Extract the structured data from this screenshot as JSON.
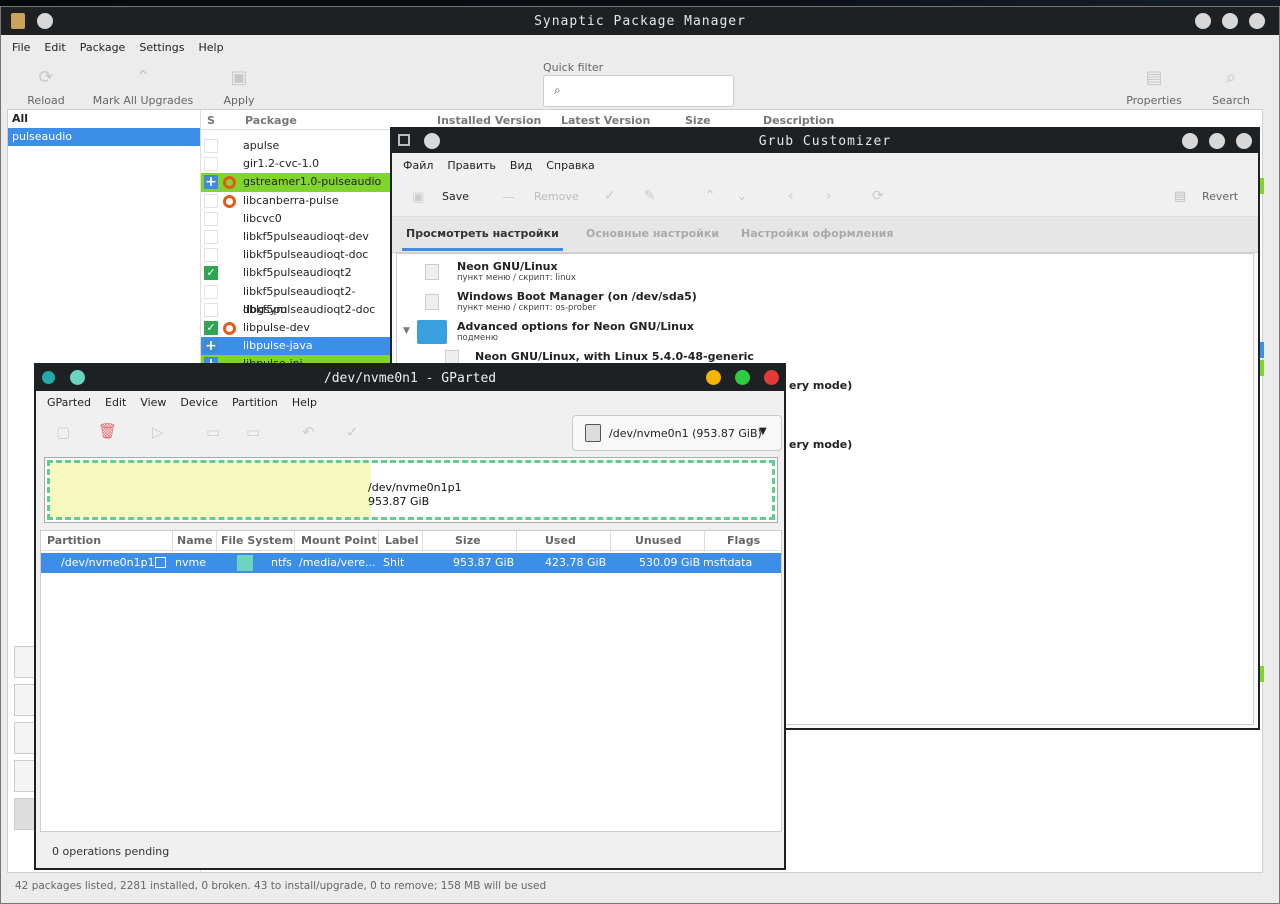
{
  "synaptic": {
    "title": "Synaptic Package Manager",
    "menu": [
      "File",
      "Edit",
      "Package",
      "Settings",
      "Help"
    ],
    "toolbar": {
      "reload": "Reload",
      "mark_all": "Mark All Upgrades",
      "apply": "Apply",
      "quick_filter": "Quick filter",
      "properties": "Properties",
      "search": "Search"
    },
    "categories": [
      "All",
      "pulseaudio"
    ],
    "columns": {
      "s": "S",
      "package": "Package",
      "installed": "Installed Version",
      "latest": "Latest Version",
      "size": "Size",
      "description": "Description"
    },
    "packages": [
      {
        "name": "apulse",
        "status": "none",
        "ubuntu": false,
        "hl": ""
      },
      {
        "name": "gir1.2-cvc-1.0",
        "status": "none",
        "ubuntu": false,
        "hl": ""
      },
      {
        "name": "gstreamer1.0-pulseaudio",
        "status": "install",
        "ubuntu": true,
        "hl": "green"
      },
      {
        "name": "libcanberra-pulse",
        "status": "none",
        "ubuntu": true,
        "hl": ""
      },
      {
        "name": "libcvc0",
        "status": "none",
        "ubuntu": false,
        "hl": ""
      },
      {
        "name": "libkf5pulseaudioqt-dev",
        "status": "none",
        "ubuntu": false,
        "hl": ""
      },
      {
        "name": "libkf5pulseaudioqt-doc",
        "status": "none",
        "ubuntu": false,
        "hl": ""
      },
      {
        "name": "libkf5pulseaudioqt2",
        "status": "installed",
        "ubuntu": false,
        "hl": ""
      },
      {
        "name": "libkf5pulseaudioqt2-dbgsym",
        "status": "none",
        "ubuntu": false,
        "hl": ""
      },
      {
        "name": "libkf5pulseaudioqt2-doc",
        "status": "none",
        "ubuntu": false,
        "hl": ""
      },
      {
        "name": "libpulse-dev",
        "status": "installed",
        "ubuntu": true,
        "hl": ""
      },
      {
        "name": "libpulse-java",
        "status": "install",
        "ubuntu": false,
        "hl": "sel"
      },
      {
        "name": "libpulse-jni",
        "status": "install",
        "ubuntu": false,
        "hl": "green"
      }
    ],
    "statusbar": "42 packages listed, 2281 installed, 0 broken. 43 to install/upgrade, 0 to remove; 158 MB will be used"
  },
  "grub": {
    "title": "Grub Customizer",
    "menu": [
      "Файл",
      "Править",
      "Вид",
      "Справка"
    ],
    "toolbar": {
      "save": "Save",
      "remove": "Remove",
      "revert": "Revert"
    },
    "tabs": [
      "Просмотреть настройки",
      "Основные настройки",
      "Настройки оформления"
    ],
    "entries": [
      {
        "title": "Neon GNU/Linux",
        "sub": "пункт меню / скрипт: linux"
      },
      {
        "title": "Windows Boot Manager (on /dev/sda5)",
        "sub": "пункт меню / скрипт: os-prober"
      },
      {
        "title": "Advanced options for Neon GNU/Linux",
        "sub": "подменю"
      }
    ],
    "child": "Neon GNU/Linux, with Linux 5.4.0-48-generic",
    "partial1": "ery mode)",
    "partial2": "ery mode)"
  },
  "gparted": {
    "title": "/dev/nvme0n1 - GParted",
    "menu": [
      "GParted",
      "Edit",
      "View",
      "Device",
      "Partition",
      "Help"
    ],
    "device": "/dev/nvme0n1 (953.87 GiB)",
    "map": {
      "name": "/dev/nvme0n1p1",
      "size": "953.87 GiB",
      "used_fraction": 0.444
    },
    "columns": [
      "Partition",
      "Name",
      "File System",
      "Mount Point",
      "Label",
      "Size",
      "Used",
      "Unused",
      "Flags"
    ],
    "row": {
      "partition": "/dev/nvme0n1p1",
      "name": "nvme",
      "fs": "ntfs",
      "mount": "/media/vere...",
      "label": "Shit",
      "size": "953.87 GiB",
      "used": "423.78 GiB",
      "unused": "530.09 GiB",
      "flags": "msftdata"
    },
    "status": "0 operations pending"
  }
}
